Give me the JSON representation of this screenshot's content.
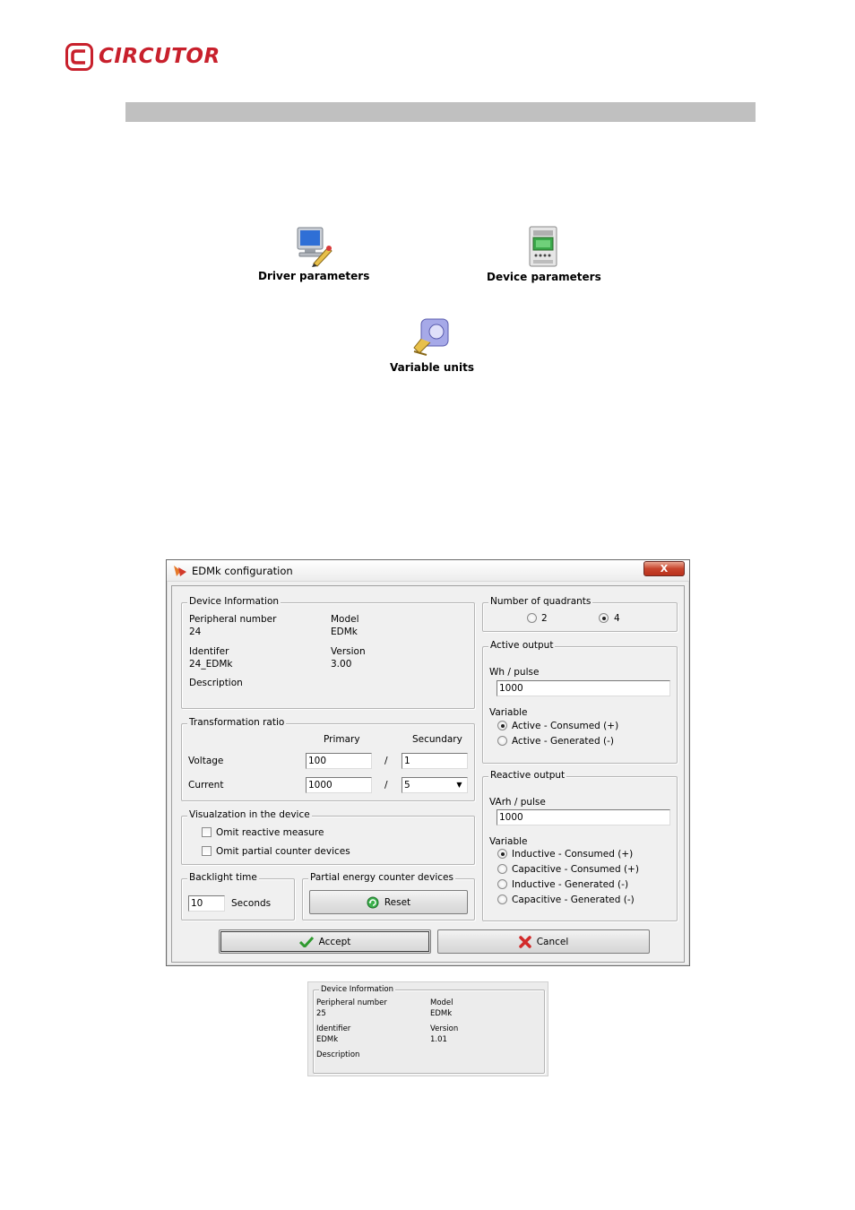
{
  "brand": {
    "name": "CIRCUTOR",
    "color": "#c8202c"
  },
  "launchers": {
    "driver": {
      "label": "Driver parameters",
      "icon": "computer-pencil-icon"
    },
    "device": {
      "label": "Device parameters",
      "icon": "meter-device-icon"
    },
    "units": {
      "label": "Variable units",
      "icon": "tape-measure-icon"
    }
  },
  "window": {
    "title": "EDMk configuration",
    "close_label": "X",
    "device_info": {
      "legend": "Device Information",
      "peripheral_label": "Peripheral number",
      "peripheral_value": "24",
      "model_label": "Model",
      "model_value": "EDMk",
      "identifier_label": "Identifer",
      "identifier_value": "24_EDMk",
      "version_label": "Version",
      "version_value": "3.00",
      "description_label": "Description"
    },
    "transformation": {
      "legend": "Transformation ratio",
      "primary_header": "Primary",
      "secondary_header": "Secundary",
      "voltage_label": "Voltage",
      "voltage_primary": "100",
      "voltage_secondary": "1",
      "current_label": "Current",
      "current_primary": "1000",
      "current_secondary": "5",
      "separator": "/"
    },
    "visualization": {
      "legend": "Visualzation in the device",
      "omit_reactive": "Omit reactive measure",
      "omit_partial": "Omit partial counter devices"
    },
    "backlight": {
      "legend": "Backlight time",
      "value": "10",
      "unit": "Seconds"
    },
    "partial": {
      "legend": "Partial energy counter devices",
      "reset_label": "Reset"
    },
    "quadrants": {
      "legend": "Number of quadrants",
      "option_2": "2",
      "option_4": "4",
      "selected": "4"
    },
    "active_output": {
      "legend": "Active output",
      "pulse_label": "Wh / pulse",
      "pulse_value": "1000",
      "variable_label": "Variable",
      "options": [
        "Active - Consumed (+)",
        "Active - Generated (-)"
      ],
      "selected_index": 0
    },
    "reactive_output": {
      "legend": "Reactive output",
      "pulse_label": "VArh / pulse",
      "pulse_value": "1000",
      "variable_label": "Variable",
      "options": [
        "Inductive - Consumed (+)",
        "Capacitive - Consumed (+)",
        "Inductive - Generated (-)",
        "Capacitive - Generated (-)"
      ],
      "selected_index": 0
    },
    "accept_label": "Accept",
    "cancel_label": "Cancel"
  },
  "mini_info": {
    "legend": "Device Information",
    "peripheral_label": "Peripheral number",
    "peripheral_value": "25",
    "model_label": "Model",
    "model_value": "EDMk",
    "identifier_label": "Identifier",
    "identifier_value": "EDMk",
    "version_label": "Version",
    "version_value": "1.01",
    "description_label": "Description"
  }
}
